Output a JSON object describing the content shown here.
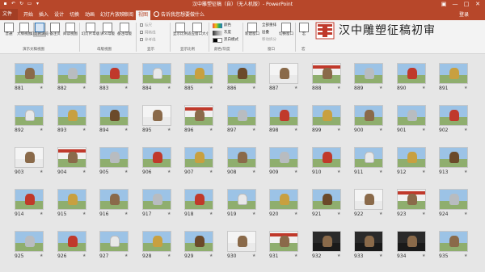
{
  "titlebar": {
    "title": "汉中雕塑征稿（自）（无人机版）- PowerPoint",
    "qat": [
      "save-icon",
      "undo-icon",
      "redo-icon",
      "slideshow-icon",
      "dropdown-icon"
    ],
    "controls": [
      "ribbon-display-icon",
      "minimize-icon",
      "maximize-icon",
      "close-icon"
    ]
  },
  "tabs": {
    "file": "文件",
    "items": [
      "开始",
      "插入",
      "设计",
      "切换",
      "动画",
      "幻灯片放映",
      "审阅",
      "视图"
    ],
    "active": "视图",
    "tellme": "告诉我您想要做什么",
    "login": "登录"
  },
  "ribbon": {
    "buttons": [
      {
        "label": "普通",
        "name": "normal-view-button"
      },
      {
        "label": "大纲视图",
        "name": "outline-view-button"
      },
      {
        "label": "幻灯片浏览",
        "name": "slide-sorter-button"
      },
      {
        "label": "备注页",
        "name": "notes-page-button"
      },
      {
        "label": "阅读视图",
        "name": "reading-view-button"
      },
      {
        "label": "幻灯片母版",
        "name": "slide-master-button"
      },
      {
        "label": "讲义母版",
        "name": "handout-master-button"
      },
      {
        "label": "备注母版",
        "name": "notes-master-button"
      },
      {
        "label": "显示比例",
        "name": "zoom-button"
      },
      {
        "label": "适应窗口大小",
        "name": "fit-to-window-button"
      },
      {
        "label": "新建窗口",
        "name": "new-window-button"
      },
      {
        "label": "切换窗口",
        "name": "switch-windows-button"
      },
      {
        "label": "宏",
        "name": "macros-button"
      }
    ],
    "show_items": [
      "标尺",
      "网格线",
      "参考线"
    ],
    "color_items": [
      "颜色",
      "灰度",
      "黑白模式"
    ],
    "window_items": [
      "全部重排",
      "层叠",
      "移动拆分"
    ],
    "groups": [
      "演示文稿视图",
      "母版视图",
      "显示",
      "显示比例",
      "颜色/灰度",
      "窗口",
      "宏"
    ],
    "brand_title": "汉中雕塑征稿初审",
    "accent": "#b7472a"
  },
  "slides": {
    "rows": [
      [
        "881",
        "882",
        "883",
        "884",
        "885",
        "886",
        "887",
        "888",
        "889",
        "890",
        "891"
      ],
      [
        "892",
        "893",
        "894",
        "895",
        "896",
        "897",
        "898",
        "899",
        "900",
        "901",
        "902"
      ],
      [
        "903",
        "904",
        "905",
        "906",
        "907",
        "908",
        "909",
        "910",
        "911",
        "912",
        "913"
      ],
      [
        "914",
        "915",
        "916",
        "917",
        "918",
        "919",
        "920",
        "921",
        "922",
        "923",
        "924"
      ],
      [
        "925",
        "926",
        "927",
        "928",
        "929",
        "930",
        "931",
        "932",
        "933",
        "934",
        "935"
      ]
    ],
    "star": "★"
  }
}
